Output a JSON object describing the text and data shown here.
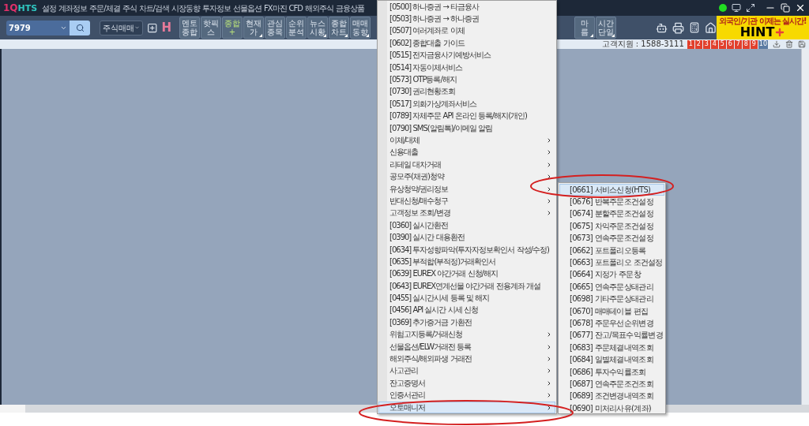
{
  "menubar": {
    "logo": {
      "mark": "1Q",
      "name": "HTS"
    },
    "items": [
      "설정",
      "계좌정보",
      "주문/체결",
      "주식",
      "차트/검색",
      "시장동향",
      "투자정보",
      "선물옵션",
      "FX마진",
      "CFD",
      "해외주식",
      "금융상품"
    ]
  },
  "toolbar": {
    "search": {
      "value": "7979"
    },
    "mode_select": {
      "value": "주식매매"
    },
    "h_button": "H",
    "buttons_left": [
      {
        "lines": [
          "멘토",
          "종합"
        ],
        "accent": false,
        "has_menu": false
      },
      {
        "lines": [
          "핫픽",
          "스"
        ],
        "accent": false,
        "has_menu": false
      },
      {
        "lines": [
          "종합",
          "+"
        ],
        "accent": true,
        "has_menu": false
      },
      {
        "lines": [
          "현재",
          "가"
        ],
        "accent": false,
        "has_menu": true
      },
      {
        "lines": [
          "관심",
          "종목"
        ],
        "accent": false,
        "has_menu": false
      },
      {
        "lines": [
          "순위",
          "분석"
        ],
        "accent": false,
        "has_menu": false
      },
      {
        "lines": [
          "뉴스",
          "시황"
        ],
        "accent": false,
        "has_menu": true
      },
      {
        "lines": [
          "종합",
          "차트"
        ],
        "accent": false,
        "has_menu": true
      },
      {
        "lines": [
          "매매",
          "동향"
        ],
        "accent": false,
        "has_menu": true
      }
    ],
    "buttons_right": [
      {
        "lines": [
          "마",
          "름"
        ],
        "accent": false,
        "has_menu": true
      },
      {
        "lines": [
          "시간",
          "단일"
        ],
        "accent": false,
        "has_menu": true
      }
    ]
  },
  "banner": {
    "line1": "외국인/기관 이제는 실시간!",
    "line2": "HINT"
  },
  "infobar": {
    "support": "고객지원 : 1588-3111",
    "pages": [
      {
        "label": "1",
        "selected": false
      },
      {
        "label": "2",
        "selected": false
      },
      {
        "label": "3",
        "selected": false
      },
      {
        "label": "4",
        "selected": false
      },
      {
        "label": "5",
        "selected": false
      },
      {
        "label": "6",
        "selected": false
      },
      {
        "label": "7",
        "selected": false
      },
      {
        "label": "8",
        "selected": false
      },
      {
        "label": "9",
        "selected": false
      },
      {
        "label": "10",
        "selected": true
      }
    ]
  },
  "menu": {
    "items": [
      {
        "label": "[0500] 하나증권 → 타금융사",
        "has_submenu": false,
        "selected": false
      },
      {
        "label": "[0503] 하나증권 → 하나증권",
        "has_submenu": false,
        "selected": false
      },
      {
        "label": "[0507] 여러계좌로 이체",
        "has_submenu": false,
        "selected": false
      },
      {
        "label": "[0602] 종합대출 가이드",
        "has_submenu": false,
        "selected": false
      },
      {
        "label": "[0515] 전자금융사기예방서비스",
        "has_submenu": false,
        "selected": false
      },
      {
        "label": "[0514] 자동이체서비스",
        "has_submenu": false,
        "selected": false
      },
      {
        "label": "[0573] OTP등록/해지",
        "has_submenu": false,
        "selected": false
      },
      {
        "label": "[0730] 권리현황조회",
        "has_submenu": false,
        "selected": false
      },
      {
        "label": "[0517] 외화가상계좌서비스",
        "has_submenu": false,
        "selected": false
      },
      {
        "label": "[0789] 자체주문 API 온라인 등록/해지(개인)",
        "has_submenu": false,
        "selected": false
      },
      {
        "label": "[0790] SMS(알림톡)/이메일 알림",
        "has_submenu": false,
        "selected": false
      },
      {
        "label": "이체/대체",
        "has_submenu": true,
        "selected": false
      },
      {
        "label": "신용대출",
        "has_submenu": true,
        "selected": false
      },
      {
        "label": "리테일 대차거래",
        "has_submenu": true,
        "selected": false
      },
      {
        "label": "공모주(채권)청약",
        "has_submenu": true,
        "selected": false
      },
      {
        "label": "유상청약/권리정보",
        "has_submenu": true,
        "selected": false
      },
      {
        "label": "반대신청/매수청구",
        "has_submenu": true,
        "selected": false
      },
      {
        "label": "고객정보 조회/변경",
        "has_submenu": true,
        "selected": false
      },
      {
        "label": "[0360] 실시간환전",
        "has_submenu": false,
        "selected": false
      },
      {
        "label": "[0390] 실시간 대용환전",
        "has_submenu": false,
        "selected": false
      },
      {
        "label": "[0634] 투자성향파악(투자자정보확인서 작성/수정)",
        "has_submenu": false,
        "selected": false
      },
      {
        "label": "[0635] 부적합(부적정)거래확인서",
        "has_submenu": false,
        "selected": false
      },
      {
        "label": "[0639] EUREX 야간거래 신청/해지",
        "has_submenu": false,
        "selected": false
      },
      {
        "label": "[0643] EUREX연계선물 야간거래 전용계좌 개설",
        "has_submenu": false,
        "selected": false
      },
      {
        "label": "[0455] 실시간시세 등록 및 해지",
        "has_submenu": false,
        "selected": false
      },
      {
        "label": "[0456] API 실시간 시세 신청",
        "has_submenu": false,
        "selected": false
      },
      {
        "label": "[0369] 추가증거금 가환전",
        "has_submenu": false,
        "selected": false
      },
      {
        "label": "위험고지등록/거래신청",
        "has_submenu": true,
        "selected": false
      },
      {
        "label": "선물옵션/ELW거래전 등록",
        "has_submenu": true,
        "selected": false
      },
      {
        "label": "해외주식/해외파생 거래전",
        "has_submenu": true,
        "selected": false
      },
      {
        "label": "사고관리",
        "has_submenu": true,
        "selected": false
      },
      {
        "label": "잔고증명서",
        "has_submenu": true,
        "selected": false
      },
      {
        "label": "인증서관리",
        "has_submenu": true,
        "selected": false
      },
      {
        "label": "오토매니저",
        "has_submenu": true,
        "selected": true
      }
    ]
  },
  "submenu": {
    "items": [
      {
        "label": "[0661] 서비스신청(HTS)",
        "selected": true
      },
      {
        "label": "[0676] 반복주문조건설정",
        "selected": false
      },
      {
        "label": "[0674] 분할주문조건설정",
        "selected": false
      },
      {
        "label": "[0675] 차익주문조건설정",
        "selected": false
      },
      {
        "label": "[0673] 연속주문조건설정",
        "selected": false
      },
      {
        "label": "[0662] 포트폴리오등록",
        "selected": false
      },
      {
        "label": "[0663] 포트폴리오 조건설정",
        "selected": false
      },
      {
        "label": "[0664] 지정가 주문창",
        "selected": false
      },
      {
        "label": "[0665] 연속주문상태관리",
        "selected": false
      },
      {
        "label": "[0698] 기타주문상태관리",
        "selected": false
      },
      {
        "label": "[0670] 매매테이블 편집",
        "selected": false
      },
      {
        "label": "[0678] 주문우선순위변경",
        "selected": false
      },
      {
        "label": "[0677] 잔고/목표수익률변경",
        "selected": false
      },
      {
        "label": "[0683] 주문체결내역조회",
        "selected": false
      },
      {
        "label": "[0684] 일별체결내역조회",
        "selected": false
      },
      {
        "label": "[0686] 투자수익률조회",
        "selected": false
      },
      {
        "label": "[0687] 연속주문조건조회",
        "selected": false
      },
      {
        "label": "[0689] 조건변경내역조회",
        "selected": false
      },
      {
        "label": "[0690] 미처리사유(계좌)",
        "selected": false
      }
    ]
  }
}
